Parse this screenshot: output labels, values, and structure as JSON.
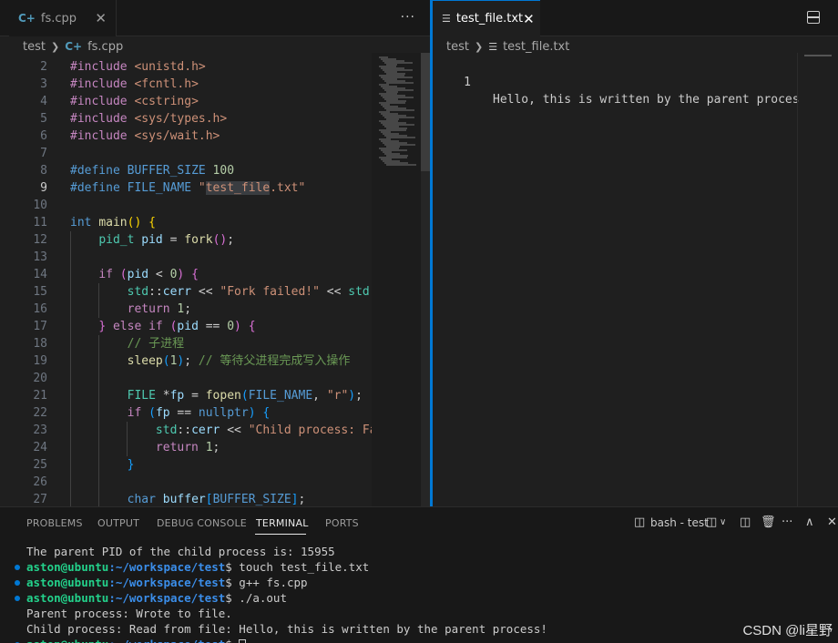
{
  "left_editor": {
    "tab_label": "fs.cpp",
    "more": "···",
    "breadcrumb": [
      "test",
      "fs.cpp"
    ],
    "lines": [
      {
        "n": "2",
        "html": "<span class='k-dir'>#include</span> <span class='k-inc'>&lt;unistd.h&gt;</span>"
      },
      {
        "n": "3",
        "html": "<span class='k-dir'>#include</span> <span class='k-inc'>&lt;fcntl.h&gt;</span>"
      },
      {
        "n": "4",
        "html": "<span class='k-dir'>#include</span> <span class='k-inc'>&lt;cstring&gt;</span>"
      },
      {
        "n": "5",
        "html": "<span class='k-dir'>#include</span> <span class='k-inc'>&lt;sys/types.h&gt;</span>"
      },
      {
        "n": "6",
        "html": "<span class='k-dir'>#include</span> <span class='k-inc'>&lt;sys/wait.h&gt;</span>"
      },
      {
        "n": "7",
        "html": ""
      },
      {
        "n": "8",
        "html": "<span class='k-kw'>#define</span> <span class='k-macro'>BUFFER_SIZE</span> <span class='k-num'>100</span>"
      },
      {
        "n": "9",
        "active": true,
        "html": "<span class='k-kw'>#define</span> <span class='k-macro'>FILE_NAME</span> <span class='k-str'>\"<span class='hl-sel'>test_file</span>.txt\"</span>"
      },
      {
        "n": "10",
        "html": ""
      },
      {
        "n": "11",
        "html": "<span class='k-kw'>int</span> <span class='k-fn'>main</span><span class='k-paren'>()</span> <span class='k-paren'>{</span>"
      },
      {
        "n": "12",
        "g": [
          1
        ],
        "html": "    <span class='k-type'>pid_t</span> <span class='k-var'>pid</span> = <span class='k-fn'>fork</span><span class='k-paren2'>()</span>;"
      },
      {
        "n": "13",
        "g": [
          1
        ],
        "html": ""
      },
      {
        "n": "14",
        "g": [
          1
        ],
        "html": "    <span class='k-ctl'>if</span> <span class='k-paren2'>(</span><span class='k-var'>pid</span> &lt; <span class='k-num'>0</span><span class='k-paren2'>)</span> <span class='k-paren2'>{</span>"
      },
      {
        "n": "15",
        "g": [
          1,
          2
        ],
        "html": "        <span class='k-type'>std</span>::<span class='k-var'>cerr</span> &lt;&lt; <span class='k-str'>\"Fork failed!\"</span> &lt;&lt; <span class='k-type'>std</span>:"
      },
      {
        "n": "16",
        "g": [
          1,
          2
        ],
        "html": "        <span class='k-ctl'>return</span> <span class='k-num'>1</span>;"
      },
      {
        "n": "17",
        "g": [
          1
        ],
        "html": "    <span class='k-paren2'>}</span> <span class='k-ctl'>else</span> <span class='k-ctl'>if</span> <span class='k-paren2'>(</span><span class='k-var'>pid</span> == <span class='k-num'>0</span><span class='k-paren2'>)</span> <span class='k-paren2'>{</span>"
      },
      {
        "n": "18",
        "g": [
          1,
          2
        ],
        "html": "        <span class='k-com'>// 子进程</span>"
      },
      {
        "n": "19",
        "g": [
          1,
          2
        ],
        "html": "        <span class='k-fn'>sleep</span><span class='k-paren3'>(</span><span class='k-num'>1</span><span class='k-paren3'>)</span>; <span class='k-com'>// 等待父进程完成写入操作</span>"
      },
      {
        "n": "20",
        "g": [
          1,
          2
        ],
        "html": ""
      },
      {
        "n": "21",
        "g": [
          1,
          2
        ],
        "html": "        <span class='k-type'>FILE</span> *<span class='k-var'>fp</span> = <span class='k-fn'>fopen</span><span class='k-paren3'>(</span><span class='k-macro'>FILE_NAME</span>, <span class='k-str'>\"r\"</span><span class='k-paren3'>)</span>;"
      },
      {
        "n": "22",
        "g": [
          1,
          2
        ],
        "html": "        <span class='k-ctl'>if</span> <span class='k-paren3'>(</span><span class='k-var'>fp</span> == <span class='k-kw'>nullptr</span><span class='k-paren3'>)</span> <span class='k-paren3'>{</span>"
      },
      {
        "n": "23",
        "g": [
          1,
          2,
          3
        ],
        "html": "            <span class='k-type'>std</span>::<span class='k-var'>cerr</span> &lt;&lt; <span class='k-str'>\"Child process: Fa</span>"
      },
      {
        "n": "24",
        "g": [
          1,
          2,
          3
        ],
        "html": "            <span class='k-ctl'>return</span> <span class='k-num'>1</span>;"
      },
      {
        "n": "25",
        "g": [
          1,
          2
        ],
        "html": "        <span class='k-paren3'>}</span>"
      },
      {
        "n": "26",
        "g": [
          1,
          2
        ],
        "html": ""
      },
      {
        "n": "27",
        "g": [
          1,
          2
        ],
        "html": "        <span class='k-kw'>char</span> <span class='k-var'>buffer</span><span class='k-paren3'>[</span><span class='k-macro'>BUFFER_SIZE</span><span class='k-paren3'>]</span>;"
      }
    ]
  },
  "right_editor": {
    "tab_label": "test_file.txt",
    "breadcrumb": [
      "test",
      "test_file.txt"
    ],
    "lines": [
      {
        "n": "1",
        "text": "Hello, this is written by the parent proces"
      }
    ]
  },
  "panel": {
    "tabs": [
      "PROBLEMS",
      "OUTPUT",
      "DEBUG CONSOLE",
      "TERMINAL",
      "PORTS"
    ],
    "active_tab": "TERMINAL",
    "terminal_name": "bash - test",
    "terminal_lines": [
      {
        "dot": false,
        "text": "The parent PID of the child process is: 15955"
      },
      {
        "dot": true,
        "user": "aston@ubuntu",
        "path": ":~/workspace/test",
        "cmd": "$ touch test_file.txt"
      },
      {
        "dot": true,
        "user": "aston@ubuntu",
        "path": ":~/workspace/test",
        "cmd": "$ g++ fs.cpp"
      },
      {
        "dot": true,
        "user": "aston@ubuntu",
        "path": ":~/workspace/test",
        "cmd": "$ ./a.out"
      },
      {
        "dot": false,
        "text": "Parent process: Wrote to file."
      },
      {
        "dot": false,
        "text": "Child process: Read from file: Hello, this is written by the parent process!"
      },
      {
        "dot": true,
        "user": "aston@ubuntu",
        "path": ":~/workspace/test",
        "cmd": "$ ",
        "cursor": true
      }
    ]
  },
  "watermark": "CSDN @li星野"
}
